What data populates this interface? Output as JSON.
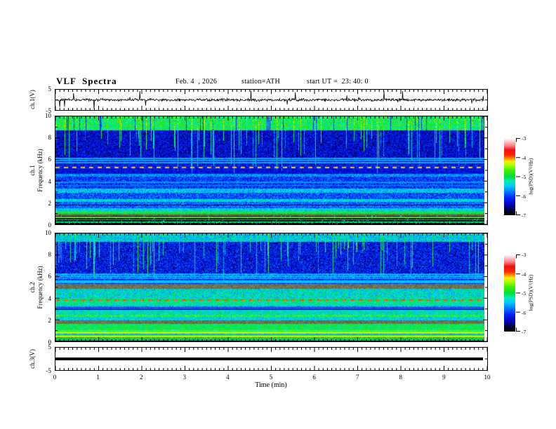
{
  "header": {
    "title": "VLF  Spectra",
    "date": "Feb. 4  , 2026",
    "station": "station=ATH",
    "start_ut": "start UT =  23: 40: 0"
  },
  "axes": {
    "time": {
      "label": "Time  (min)",
      "major_ticks": [
        0,
        1,
        2,
        3,
        4,
        5,
        6,
        7,
        8,
        9,
        10
      ],
      "minor_step": 0.1,
      "range_min": [
        0,
        10
      ]
    },
    "ch1_wave": {
      "label": "ch.1(V)",
      "ticks": [
        5,
        -5
      ],
      "range_v": [
        -5,
        5
      ]
    },
    "spec1": {
      "line1": "ch.1",
      "line2": "Frequency  (kHz)",
      "ticks": [
        10,
        8,
        6,
        4,
        2,
        0
      ],
      "minor_step_khz": 1,
      "range_khz": [
        0,
        10
      ]
    },
    "spec2": {
      "line1": "ch.2",
      "line2": "Frequency  (kHz)",
      "ticks": [
        10,
        8,
        6,
        4,
        2,
        0
      ],
      "minor_step_khz": 1,
      "range_khz": [
        0,
        10
      ]
    },
    "ch3": {
      "label": "ch.3(V)",
      "ticks": [
        5,
        -5
      ],
      "range_v": [
        -5,
        5
      ]
    }
  },
  "colorbar": {
    "label": "log(PSD)(V²/Hz)",
    "ticks": [
      -3,
      -4,
      -5,
      -6,
      -7
    ],
    "range": [
      -7,
      -3
    ],
    "stops": [
      [
        0,
        "#000000"
      ],
      [
        0.05,
        "#000022"
      ],
      [
        0.12,
        "#0000aa"
      ],
      [
        0.22,
        "#0022ff"
      ],
      [
        0.3,
        "#0077ff"
      ],
      [
        0.38,
        "#00ccff"
      ],
      [
        0.44,
        "#00eeb0"
      ],
      [
        0.5,
        "#00dd44"
      ],
      [
        0.58,
        "#44ee00"
      ],
      [
        0.65,
        "#aaff00"
      ],
      [
        0.7,
        "#ffee00"
      ],
      [
        0.74,
        "#ff8800"
      ],
      [
        0.78,
        "#ff2a00"
      ],
      [
        0.85,
        "#ee1111"
      ],
      [
        0.9,
        "#ff7777"
      ],
      [
        0.95,
        "#ffbbbb"
      ],
      [
        1,
        "#ffffff"
      ]
    ]
  },
  "chart_data": [
    {
      "type": "line",
      "name": "ch1-voltage-waveform",
      "ylabel": "ch.1(V)",
      "y_range": [
        -5,
        5
      ],
      "x_range_min": [
        0,
        10
      ],
      "signal": {
        "kind": "random-noise",
        "seed": 42,
        "points": 900,
        "sigma_v": 0.8,
        "spike_probability": 0.03,
        "spike_min_v": 1.0,
        "spike_max_v": 4.3,
        "x_end_min": 9.93
      }
    },
    {
      "type": "heatmap",
      "name": "ch1-spectrogram",
      "ylabel": "ch.1 Frequency (kHz)",
      "y_range_khz": [
        0,
        10
      ],
      "z_range_log_psd": [
        -7,
        -3
      ],
      "x_end_min": 9.93,
      "seed": 7,
      "bands": [
        {
          "f_lo": 8.7,
          "f_hi": 10.0,
          "level": -5.0,
          "noise": 0.45,
          "vs": 0.35,
          "darkgap": 0.07
        },
        {
          "f_lo": 5.55,
          "f_hi": 8.7,
          "level": -6.35,
          "noise": 0.4,
          "vs": 1.0
        },
        {
          "f_lo": 5.1,
          "f_hi": 5.55,
          "level": -6.2,
          "noise": 0.35,
          "vs": 0.7
        },
        {
          "f_lo": 4.65,
          "f_hi": 5.1,
          "level": -6.3,
          "noise": 0.3,
          "vs": 0.5
        },
        {
          "f_lo": 4.4,
          "f_hi": 4.65,
          "level": -5.7,
          "noise": 0.3,
          "vs": 0.3
        },
        {
          "f_lo": 3.3,
          "f_hi": 4.4,
          "level": -6.05,
          "noise": 0.4,
          "vs": 0.4
        },
        {
          "f_lo": 2.95,
          "f_hi": 3.3,
          "level": -5.5,
          "noise": 0.3,
          "vs": 0.2
        },
        {
          "f_lo": 2.35,
          "f_hi": 2.95,
          "level": -5.95,
          "noise": 0.4,
          "vs": 0.3
        },
        {
          "f_lo": 2.1,
          "f_hi": 2.35,
          "level": -5.4,
          "noise": 0.3,
          "vs": 0.2
        },
        {
          "f_lo": 1.5,
          "f_hi": 2.1,
          "level": -5.85,
          "noise": 0.35,
          "vs": 0.2
        },
        {
          "f_lo": 1.25,
          "f_hi": 1.5,
          "level": -5.45,
          "noise": 0.3,
          "vs": 0.15
        },
        {
          "f_lo": 0.97,
          "f_hi": 1.25,
          "level": -4.95,
          "noise": 0.3,
          "vs": 0.1
        },
        {
          "f_lo": 0.8,
          "f_hi": 0.97,
          "level": -5.2,
          "noise": 0.3,
          "gray": true
        },
        {
          "f_lo": 0.0,
          "f_hi": 0.8,
          "level": -6.9,
          "noise": 0.12,
          "speckle": 0.05,
          "speckle_level": -5.4
        }
      ],
      "lines": [
        {
          "f": 6.1,
          "level": -5.6
        },
        {
          "f": 5.9,
          "level": -5.65
        },
        {
          "f": 5.7,
          "level": -5.6
        },
        {
          "f": 5.25,
          "level": -4.15,
          "dash": 6,
          "gap_level": -6.2
        },
        {
          "f": 3.9,
          "level": -5.7
        },
        {
          "f": 3.6,
          "level": -5.75
        },
        {
          "f": 1.8,
          "level": -6.6
        },
        {
          "f": 0.65,
          "level": -4.65
        },
        {
          "f": 0.42,
          "level": -4.85
        },
        {
          "f": 0.18,
          "level": -5.1
        }
      ],
      "streaks": {
        "probability": 0.12,
        "boost_min": 0.5,
        "boost_max": 1.6,
        "fmin_min": 4.5,
        "fmin_max": 8.0
      }
    },
    {
      "type": "heatmap",
      "name": "ch2-spectrogram",
      "ylabel": "ch.2 Frequency (kHz)",
      "y_range_khz": [
        0,
        10
      ],
      "z_range_log_psd": [
        -7,
        -3
      ],
      "x_end_min": 9.93,
      "seed": 19,
      "bands": [
        {
          "f_lo": 9.25,
          "f_hi": 10.0,
          "level": -5.45,
          "noise": 0.4,
          "vs": 0.3
        },
        {
          "f_lo": 6.3,
          "f_hi": 9.25,
          "level": -6.25,
          "noise": 0.45,
          "vs": 1.0
        },
        {
          "f_lo": 5.75,
          "f_hi": 6.3,
          "level": -5.75,
          "noise": 0.35,
          "vs": 0.5
        },
        {
          "f_lo": 5.35,
          "f_hi": 5.75,
          "level": -6.1,
          "noise": 0.35,
          "vs": 0.4
        },
        {
          "f_lo": 4.9,
          "f_hi": 5.35,
          "level": -5.0,
          "noise": 0.3,
          "gray": true
        },
        {
          "f_lo": 3.95,
          "f_hi": 4.9,
          "level": -5.35,
          "noise": 0.4,
          "vs": 0.15
        },
        {
          "f_lo": 3.3,
          "f_hi": 3.95,
          "level": -5.2,
          "noise": 0.35,
          "vs": 0.1
        },
        {
          "f_lo": 2.95,
          "f_hi": 3.3,
          "level": -5.5,
          "noise": 0.35,
          "vs": 0.1
        },
        {
          "f_lo": 2.5,
          "f_hi": 2.95,
          "level": -5.3,
          "noise": 0.35,
          "vs": 0.1
        },
        {
          "f_lo": 2.25,
          "f_hi": 2.5,
          "level": -4.85,
          "noise": 0.4,
          "vs": 0.1
        },
        {
          "f_lo": 1.95,
          "f_hi": 2.25,
          "level": -5.4,
          "noise": 0.3,
          "vs": 0.1
        },
        {
          "f_lo": 1.6,
          "f_hi": 1.95,
          "level": -5.0,
          "noise": 0.3,
          "gray": true
        },
        {
          "f_lo": 0.88,
          "f_hi": 1.6,
          "level": -5.0,
          "noise": 0.3,
          "vs": 0.1
        },
        {
          "f_lo": 0.7,
          "f_hi": 0.88,
          "level": -4.35,
          "noise": 0.15
        },
        {
          "f_lo": 0.08,
          "f_hi": 0.7,
          "level": -5.7,
          "noise": 0.25
        },
        {
          "f_lo": 0.0,
          "f_hi": 0.08,
          "level": -7.0,
          "noise": 0.05
        }
      ],
      "lines": [
        {
          "f": 6.2,
          "level": -5.5
        },
        {
          "f": 6.0,
          "level": -5.55
        },
        {
          "f": 5.8,
          "level": -5.6
        },
        {
          "f": 5.6,
          "level": -5.5
        },
        {
          "f": 5.45,
          "level": -5.55
        },
        {
          "f": 3.85,
          "level": -3.95,
          "dash": 6,
          "gap_level": -5.0
        },
        {
          "f": 3.15,
          "level": -6.3
        },
        {
          "f": 3.0,
          "level": -6.35
        },
        {
          "f": 1.0,
          "level": -4.55
        },
        {
          "f": 0.6,
          "level": -4.8
        },
        {
          "f": 0.45,
          "level": -4.25
        },
        {
          "f": 0.3,
          "level": -4.8
        },
        {
          "f": 0.15,
          "level": -4.9
        }
      ],
      "streaks": {
        "probability": 0.13,
        "boost_min": 0.5,
        "boost_max": 1.5,
        "fmin_min": 5.3,
        "fmin_max": 8.7
      }
    },
    {
      "type": "line",
      "name": "ch3-voltage-waveform",
      "ylabel": "ch.3(V)",
      "y_range": [
        -5,
        5
      ],
      "x_range_min": [
        0,
        10
      ],
      "signal": {
        "kind": "constant",
        "value_v": 0.0,
        "x_end_min": 9.9
      }
    }
  ]
}
